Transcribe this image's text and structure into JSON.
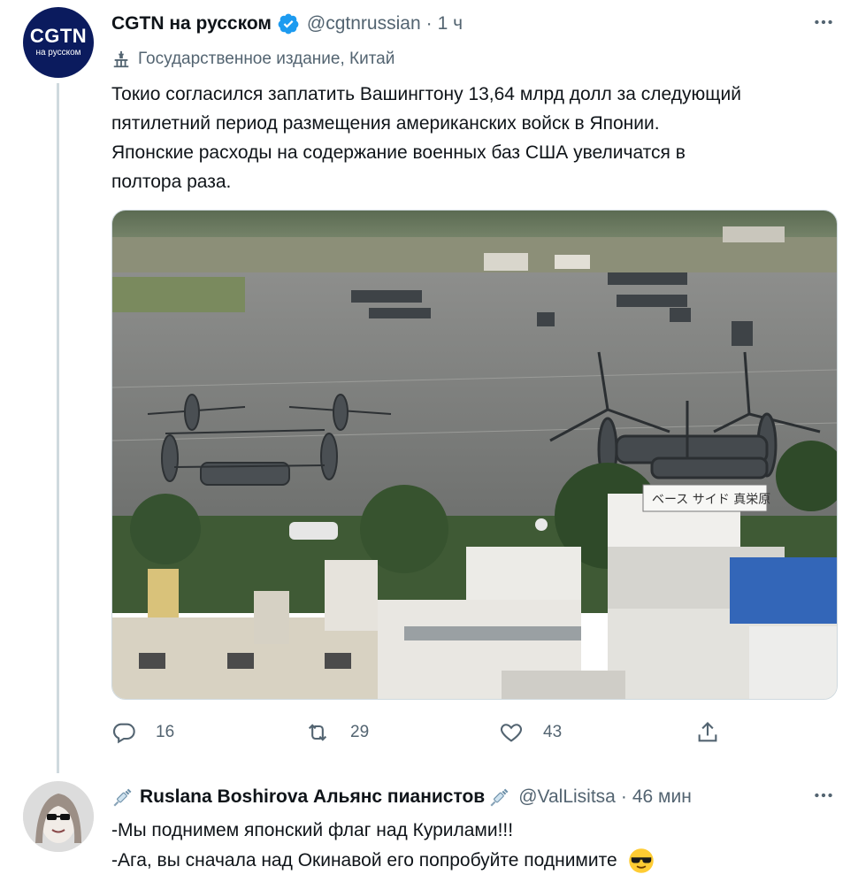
{
  "tweet": {
    "avatar_logo": "CGTN",
    "avatar_sub": "на русском",
    "display_name": "CGTN на русском",
    "handle": "@cgtnrussian",
    "separator": "·",
    "time": "1 ч",
    "label": "Государственное издание, Китай",
    "text_lines": [
      "Токио согласился заплатить Вашингтону 13,64 млрд долл за следующий",
      "пятилетний период размещения американских войск в Японии.",
      "Японские расходы на содержание военных баз США увеличатся в",
      "полтора раза."
    ],
    "media_sign": "ベース サイド 真栄原",
    "reply_count": "16",
    "retweet_count": "29",
    "like_count": "43"
  },
  "reply": {
    "display_name": "Ruslana Boshirova Альянс пианистов",
    "handle": "@ValLisitsa",
    "separator": "·",
    "time": "46 мин",
    "text_lines": [
      "-Мы поднимем японский флаг над Курилами!!!",
      "-Ага, вы сначала над Окинавой его попробуйте поднимите"
    ]
  },
  "icons": {
    "verified": "verified-badge-icon",
    "more": "more-dots-icon",
    "state": "state-media-icon",
    "reply": "reply-icon",
    "retweet": "retweet-icon",
    "like": "heart-icon",
    "share": "share-icon",
    "syringe": "syringe-icon",
    "sunglasses": "sunglasses-emoji-icon"
  },
  "colors": {
    "text": "#0f1419",
    "muted": "#536471",
    "verified": "#1d9bf0",
    "thread_line": "#cfd9de",
    "avatar_bg": "#0b1b5e"
  }
}
